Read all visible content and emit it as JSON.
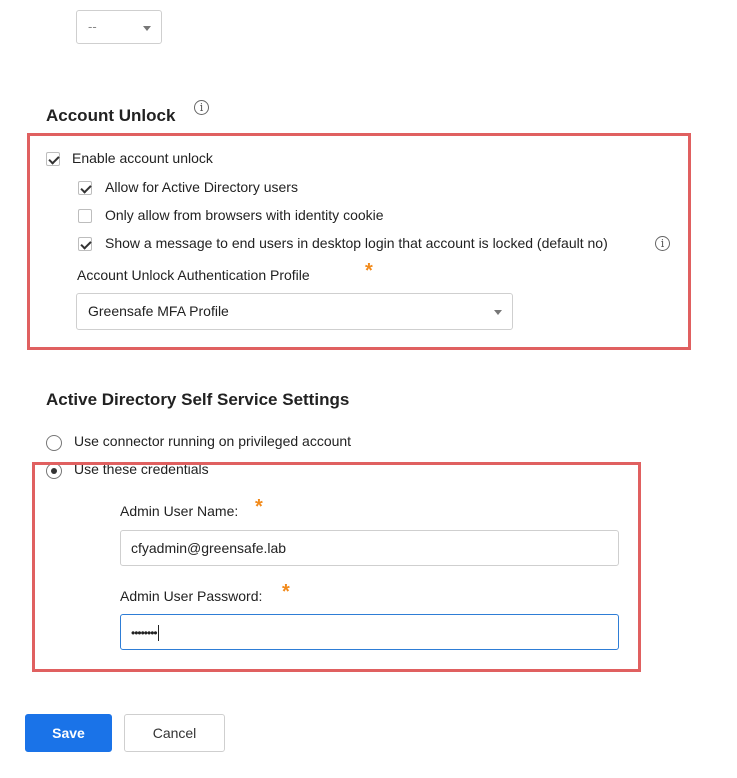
{
  "top_select": {
    "value": "--"
  },
  "account_unlock": {
    "title": "Account Unlock",
    "title_info_icon": "info-icon",
    "enable_label": "Enable account unlock",
    "enable_checked": true,
    "options": [
      {
        "label": "Allow for Active Directory users",
        "checked": true
      },
      {
        "label": "Only allow from browsers with identity cookie",
        "checked": false
      },
      {
        "label": "Show a message to end users in desktop login that account is locked (default no)",
        "checked": true
      }
    ],
    "profile_label": "Account Unlock Authentication Profile",
    "profile_value": "Greensafe MFA Profile",
    "required_mark": "*"
  },
  "ad_self_service": {
    "title": "Active Directory Self Service Settings",
    "radio_options": [
      {
        "label": "Use connector running on privileged account",
        "selected": false
      },
      {
        "label": "Use these credentials",
        "selected": true
      }
    ],
    "admin_user_label": "Admin User Name:",
    "admin_user_value": "cfyadmin@greensafe.lab",
    "admin_password_label": "Admin User Password:",
    "admin_password_value": "••••••••",
    "required_mark": "*"
  },
  "footer": {
    "save_label": "Save",
    "cancel_label": "Cancel"
  },
  "colors": {
    "primary": "#1a73e8",
    "highlight": "#e06060",
    "required": "#f28a1a",
    "focus": "#2e7dd6"
  }
}
